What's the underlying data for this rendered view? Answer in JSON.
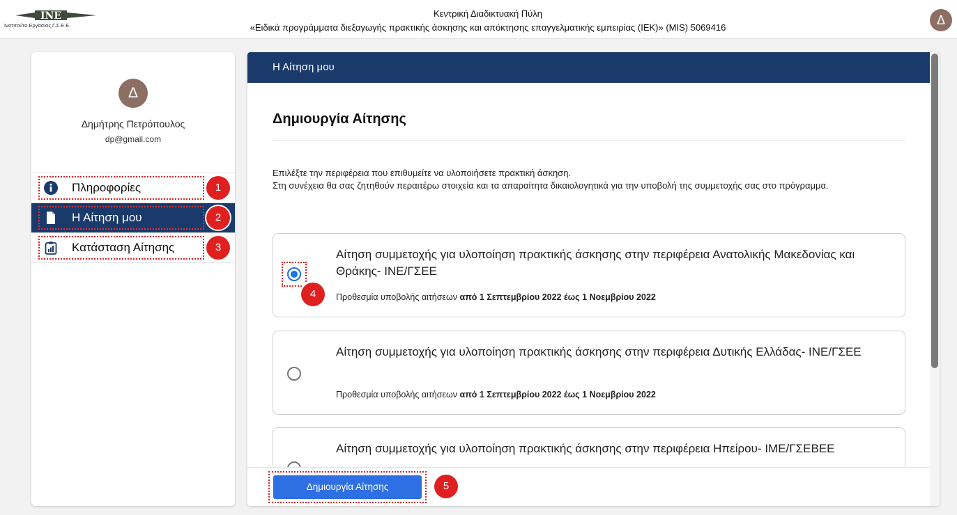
{
  "header": {
    "logo_text": "Ινστιτούτο Εργασίας Γ.Σ.Ε.Ε.",
    "logo_mark": "ΙΝΕ",
    "title_line1": "Κεντρική Διαδικτυακή Πύλη",
    "title_line2": "«Ειδικά προγράμματα διεξαγωγής πρακτικής άσκησης και απόκτησης επαγγελματικής εμπειρίας (ΙΕΚ)» (MIS) 5069416",
    "avatar_initial": "Δ"
  },
  "profile": {
    "avatar_initial": "Δ",
    "name": "Δημήτρης Πετρόπουλος",
    "email": "dp@gmail.com"
  },
  "nav": {
    "items": [
      {
        "label": "Πληροφορίες",
        "icon": "info-icon",
        "badge": "1"
      },
      {
        "label": "Η Αίτηση μου",
        "icon": "document-icon",
        "badge": "2",
        "active": true
      },
      {
        "label": "Κατάσταση Αίτησης",
        "icon": "status-report-icon",
        "badge": "3"
      }
    ]
  },
  "main": {
    "header": "Η Αίτηση μου",
    "section_title": "Δημιουργία Αίτησης",
    "intro_line1": "Επιλέξτε την περιφέρεια που επιθυμείτε να υλοποιήσετε πρακτική άσκηση.",
    "intro_line2": "Στη συνέχεια θα σας ζητηθούν περαιτέρω στοιχεία και τα απαραίτητα δικαιολογητικά για την υποβολή της συμμετοχής σας στο πρόγραμμα.",
    "options": [
      {
        "title": "Αίτηση συμμετοχής για υλοποίηση πρακτικής άσκησης στην περιφέρεια Ανατολικής Μακεδονίας και Θράκης- ΙΝΕ/ΓΣΕΕ",
        "deadline_prefix": "Προθεσμία υποβολής αιτήσεων",
        "deadline_value": "από 1 Σεπτεμβρίου 2022 έως 1 Νοεμβρίου 2022",
        "selected": true,
        "badge": "4"
      },
      {
        "title": "Αίτηση συμμετοχής για υλοποίηση πρακτικής άσκησης στην περιφέρεια Δυτικής Ελλάδας- ΙΝΕ/ΓΣΕΕ",
        "deadline_prefix": "Προθεσμία υποβολής αιτήσεων",
        "deadline_value": "από 1 Σεπτεμβρίου 2022 έως 1 Νοεμβρίου 2022",
        "selected": false
      },
      {
        "title": "Αίτηση συμμετοχής για υλοποίηση πρακτικής άσκησης στην περιφέρεια Ηπείρου- ΙΜΕ/ΓΣΕΒΕΕ",
        "selected": false
      }
    ],
    "create_button": "Δημιουργία Αίτησης",
    "create_badge": "5"
  },
  "colors": {
    "primary_navy": "#1a3a6b",
    "button_blue": "#2f6fe4",
    "badge_red": "#e02020",
    "avatar_brown": "#8d6e63"
  }
}
